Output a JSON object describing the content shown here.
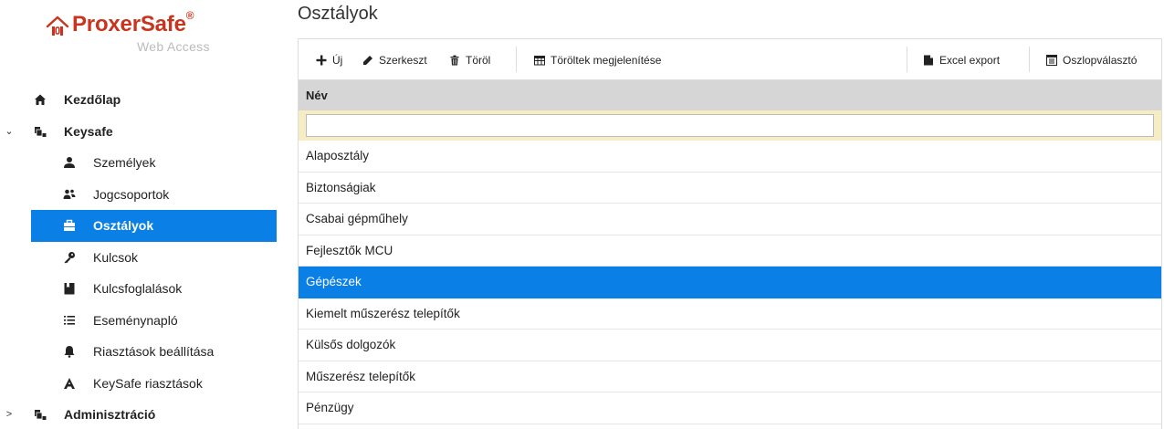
{
  "logo": {
    "brand": "ProxerSafe",
    "reg": "®",
    "sub": "Web Access"
  },
  "nav": {
    "home": {
      "label": "Kezdőlap",
      "icon": "home-icon"
    },
    "keysafe": {
      "label": "Keysafe",
      "icon": "cabinet-icon",
      "expanded": true
    },
    "keysafe_items": [
      {
        "label": "Személyek",
        "icon": "person-icon"
      },
      {
        "label": "Jogcsoportok",
        "icon": "group-icon"
      },
      {
        "label": "Osztályok",
        "icon": "briefcase-icon",
        "active": true
      },
      {
        "label": "Kulcsok",
        "icon": "key-icon"
      },
      {
        "label": "Kulcsfoglalások",
        "icon": "bookmark-icon"
      },
      {
        "label": "Eseménynapló",
        "icon": "list-icon"
      },
      {
        "label": "Riasztások beállítása",
        "icon": "bell-icon"
      },
      {
        "label": "KeySafe riasztások",
        "icon": "alert-a-icon"
      }
    ],
    "admin": {
      "label": "Adminisztráció",
      "icon": "cabinet-icon",
      "expanded": false
    }
  },
  "page": {
    "title": "Osztályok"
  },
  "toolbar": {
    "new": "Új",
    "edit": "Szerkeszt",
    "delete": "Töröl",
    "show_deleted": "Töröltek megjelenítése",
    "excel_export": "Excel export",
    "column_chooser": "Oszlopválasztó"
  },
  "grid": {
    "column_header": "Név",
    "filter_value": "",
    "rows": [
      "Alaposztály",
      "Biztonságiak",
      "Csabai gépműhely",
      "Fejlesztők MCU",
      "Gépészek",
      "Kiemelt műszerész telepítők",
      "Külsős dolgozók",
      "Műszerész telepítők",
      "Pénzügy"
    ],
    "selected_row": "Gépészek"
  },
  "colors": {
    "accent": "#0a7fe6",
    "brand": "#c8341e",
    "filter_bg": "#f7edc4",
    "header_bg": "#d6d6d6"
  }
}
